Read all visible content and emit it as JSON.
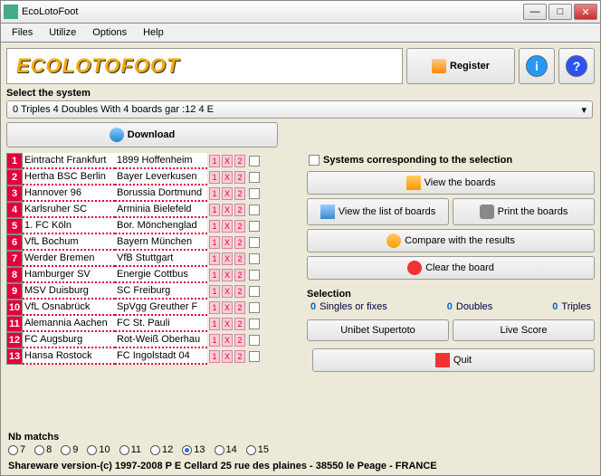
{
  "window": {
    "title": "EcoLotoFoot"
  },
  "menu": {
    "items": [
      "Files",
      "Utilize",
      "Options",
      "Help"
    ]
  },
  "logo": "ECOLOTOFOOT",
  "register_btn": "Register",
  "system_label": "Select the system",
  "system_value": "0 Triples  4 Doubles  With     4 boards gar :12 4 E",
  "download_btn": "Download",
  "matches": [
    {
      "n": "1",
      "home": "Eintracht Frankfurt",
      "away": "1899 Hoffenheim"
    },
    {
      "n": "2",
      "home": "Hertha BSC Berlin",
      "away": "Bayer Leverkusen"
    },
    {
      "n": "3",
      "home": "Hannover 96",
      "away": "Borussia Dortmund"
    },
    {
      "n": "4",
      "home": "Karlsruher SC",
      "away": "Arminia Bielefeld"
    },
    {
      "n": "5",
      "home": "1. FC Köln",
      "away": "Bor. Mönchenglad"
    },
    {
      "n": "6",
      "home": "VfL Bochum",
      "away": "Bayern München"
    },
    {
      "n": "7",
      "home": "Werder Bremen",
      "away": "VfB Stuttgart"
    },
    {
      "n": "8",
      "home": "Hamburger SV",
      "away": "Energie Cottbus"
    },
    {
      "n": "9",
      "home": "MSV Duisburg",
      "away": "SC Freiburg"
    },
    {
      "n": "10",
      "home": "VfL Osnabrück",
      "away": "SpVgg Greuther F"
    },
    {
      "n": "11",
      "home": "Alemannia Aachen",
      "away": "FC St. Pauli"
    },
    {
      "n": "12",
      "home": "FC Augsburg",
      "away": "Rot-Weiß Oberhau"
    },
    {
      "n": "13",
      "home": "Hansa Rostock",
      "away": "FC Ingolstadt 04"
    }
  ],
  "bet_marks": [
    "1",
    "X",
    "2"
  ],
  "systems_chk": "Systems corresponding to the selection",
  "rpanel": {
    "view_boards": "View the boards",
    "view_list": "View the list of boards",
    "print": "Print the boards",
    "compare": "Compare with the results",
    "clear": "Clear the board"
  },
  "selection": {
    "label": "Selection",
    "singles": {
      "v": "0",
      "l": "Singles or fixes"
    },
    "doubles": {
      "v": "0",
      "l": "Doubles"
    },
    "triples": {
      "v": "0",
      "l": "Triples"
    }
  },
  "unibet": "Unibet Supertoto",
  "livescore": "Live Score",
  "quit": "Quit",
  "nb_label": "Nb matchs",
  "nb_options": [
    "7",
    "8",
    "9",
    "10",
    "11",
    "12",
    "13",
    "14",
    "15"
  ],
  "nb_selected": "13",
  "shareware": "Shareware version-(c) 1997-2008 P E Cellard 25 rue des plaines - 38550 le Peage - FRANCE"
}
